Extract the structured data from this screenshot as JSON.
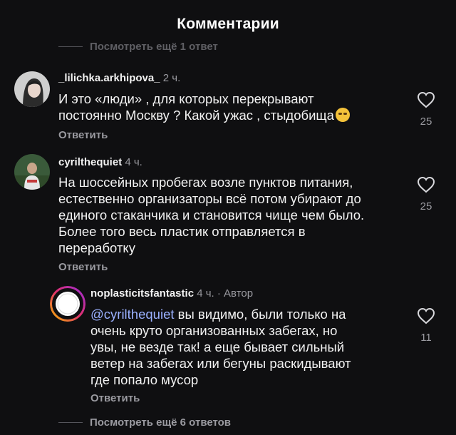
{
  "header": {
    "title": "Комментарии"
  },
  "top_view_more": "Посмотреть ещё 1 ответ",
  "comments": [
    {
      "username": "_lilichka.arkhipova_",
      "time": "2 ч.",
      "lines": [
        "И это «люди» , для которых перекрывают",
        "постоянно Москву ? Какой ужас , стыдобища"
      ],
      "emoji": "loudly-crying-face",
      "reply_label": "Ответить",
      "likes": "25"
    },
    {
      "username": "cyrilthequiet",
      "time": "4 ч.",
      "lines": [
        "На шоссейных пробегах возле пунктов питания,",
        "естественно организаторы всё потом убирают до",
        "единого стаканчика и становится чище чем было.",
        "Более того весь пластик отправляется в",
        "переработку"
      ],
      "reply_label": "Ответить",
      "likes": "25"
    },
    {
      "username": "noplasticitsfantastic",
      "time": "4 ч.",
      "author_tag": "· Автор",
      "mention": "@cyrilthequiet",
      "lines": [
        " вы видимо, были только на",
        "очень круто организованных забегах, но",
        "увы, не везде так! а еще бывает сильный",
        "ветер на забегах или бегуны раскидывают",
        "где попало мусор"
      ],
      "reply_label": "Ответить",
      "likes": "11"
    }
  ],
  "bottom_view_more": "Посмотреть ещё 6 ответов",
  "colors": {
    "background": "#0f0f11",
    "mention": "#9ab0ff",
    "secondary_text": "#9a9aa0"
  }
}
